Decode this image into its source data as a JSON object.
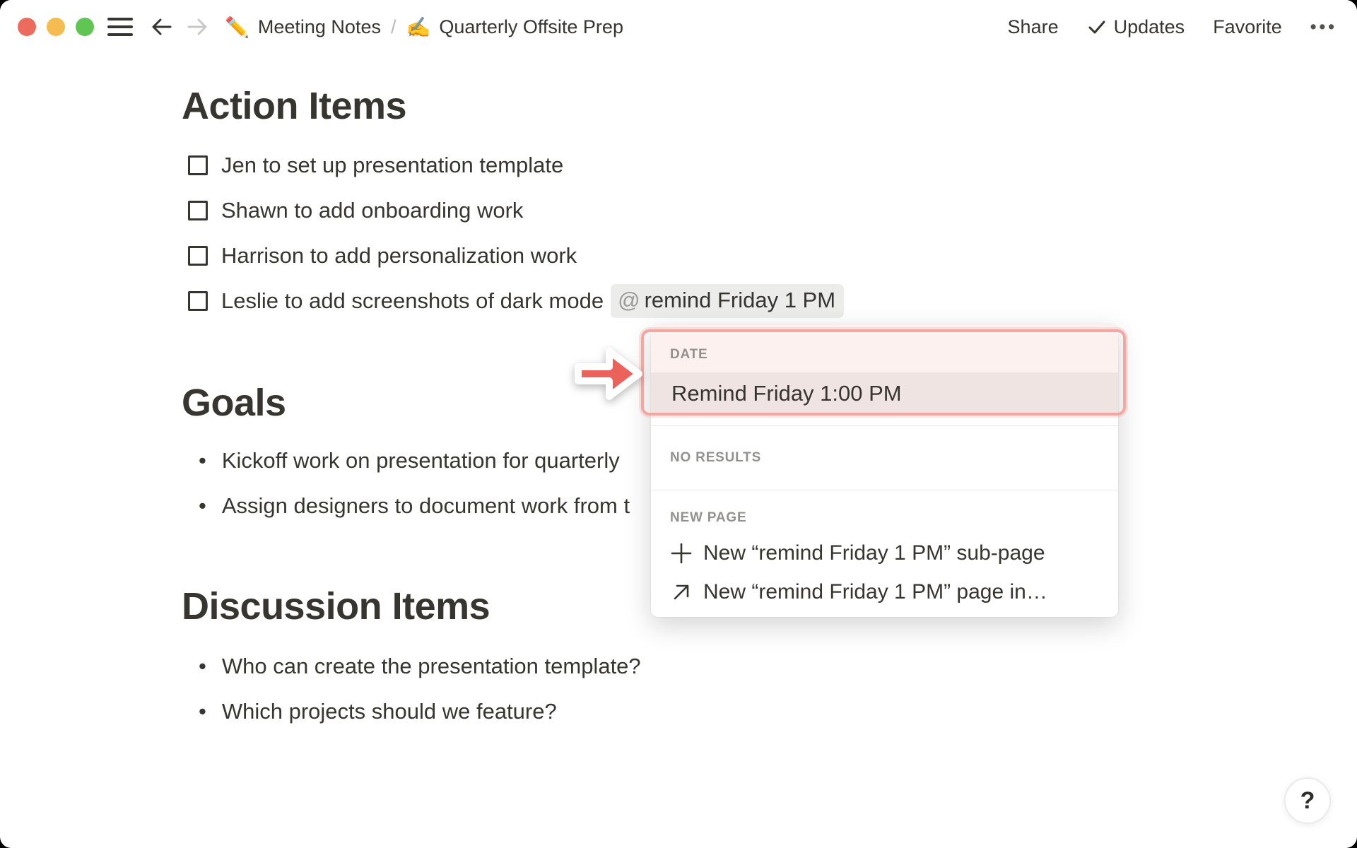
{
  "topbar": {
    "breadcrumb": {
      "root_emoji": "✏️",
      "root": "Meeting Notes",
      "separator": "/",
      "page_emoji": "✍️",
      "page": "Quarterly Offsite Prep"
    },
    "actions": {
      "share": "Share",
      "updates": "Updates",
      "favorite": "Favorite",
      "more": "•••"
    }
  },
  "doc": {
    "action_items": {
      "heading": "Action Items",
      "todos": [
        {
          "text": "Jen to set up presentation template"
        },
        {
          "text": "Shawn to add onboarding work"
        },
        {
          "text": "Harrison to add personalization work"
        },
        {
          "text": "Leslie to add screenshots of dark mode",
          "mention": {
            "at": "@",
            "label": "remind Friday 1 PM"
          }
        }
      ]
    },
    "goals": {
      "heading": "Goals",
      "bullets": [
        {
          "text": "Kickoff work on presentation for quarterly"
        },
        {
          "text": "Assign designers to document work from t"
        }
      ]
    },
    "discussion": {
      "heading": "Discussion Items",
      "bullets": [
        {
          "text": "Who can create the presentation template?"
        },
        {
          "text": "Which projects should we feature?"
        }
      ]
    }
  },
  "mention_menu": {
    "date_label": "DATE",
    "date_result": "Remind Friday 1:00 PM",
    "no_results_label": "NO RESULTS",
    "new_page_label": "NEW PAGE",
    "items": [
      {
        "icon": "plus-icon",
        "text": "New “remind Friday 1 PM” sub-page"
      },
      {
        "icon": "arrow-up-right-icon",
        "text": "New “remind Friday 1 PM” page in…"
      }
    ]
  },
  "help": {
    "label": "?"
  },
  "accent_colors": {
    "annotation_red": "#EB625A",
    "annotation_pink_border": "#F2A8A2",
    "date_header_pink": "#FDF1F0",
    "selected_row_pink": "#F0E4E2",
    "token_background": "#ECECEB",
    "text": "#37352F",
    "muted_label": "#92918E"
  }
}
